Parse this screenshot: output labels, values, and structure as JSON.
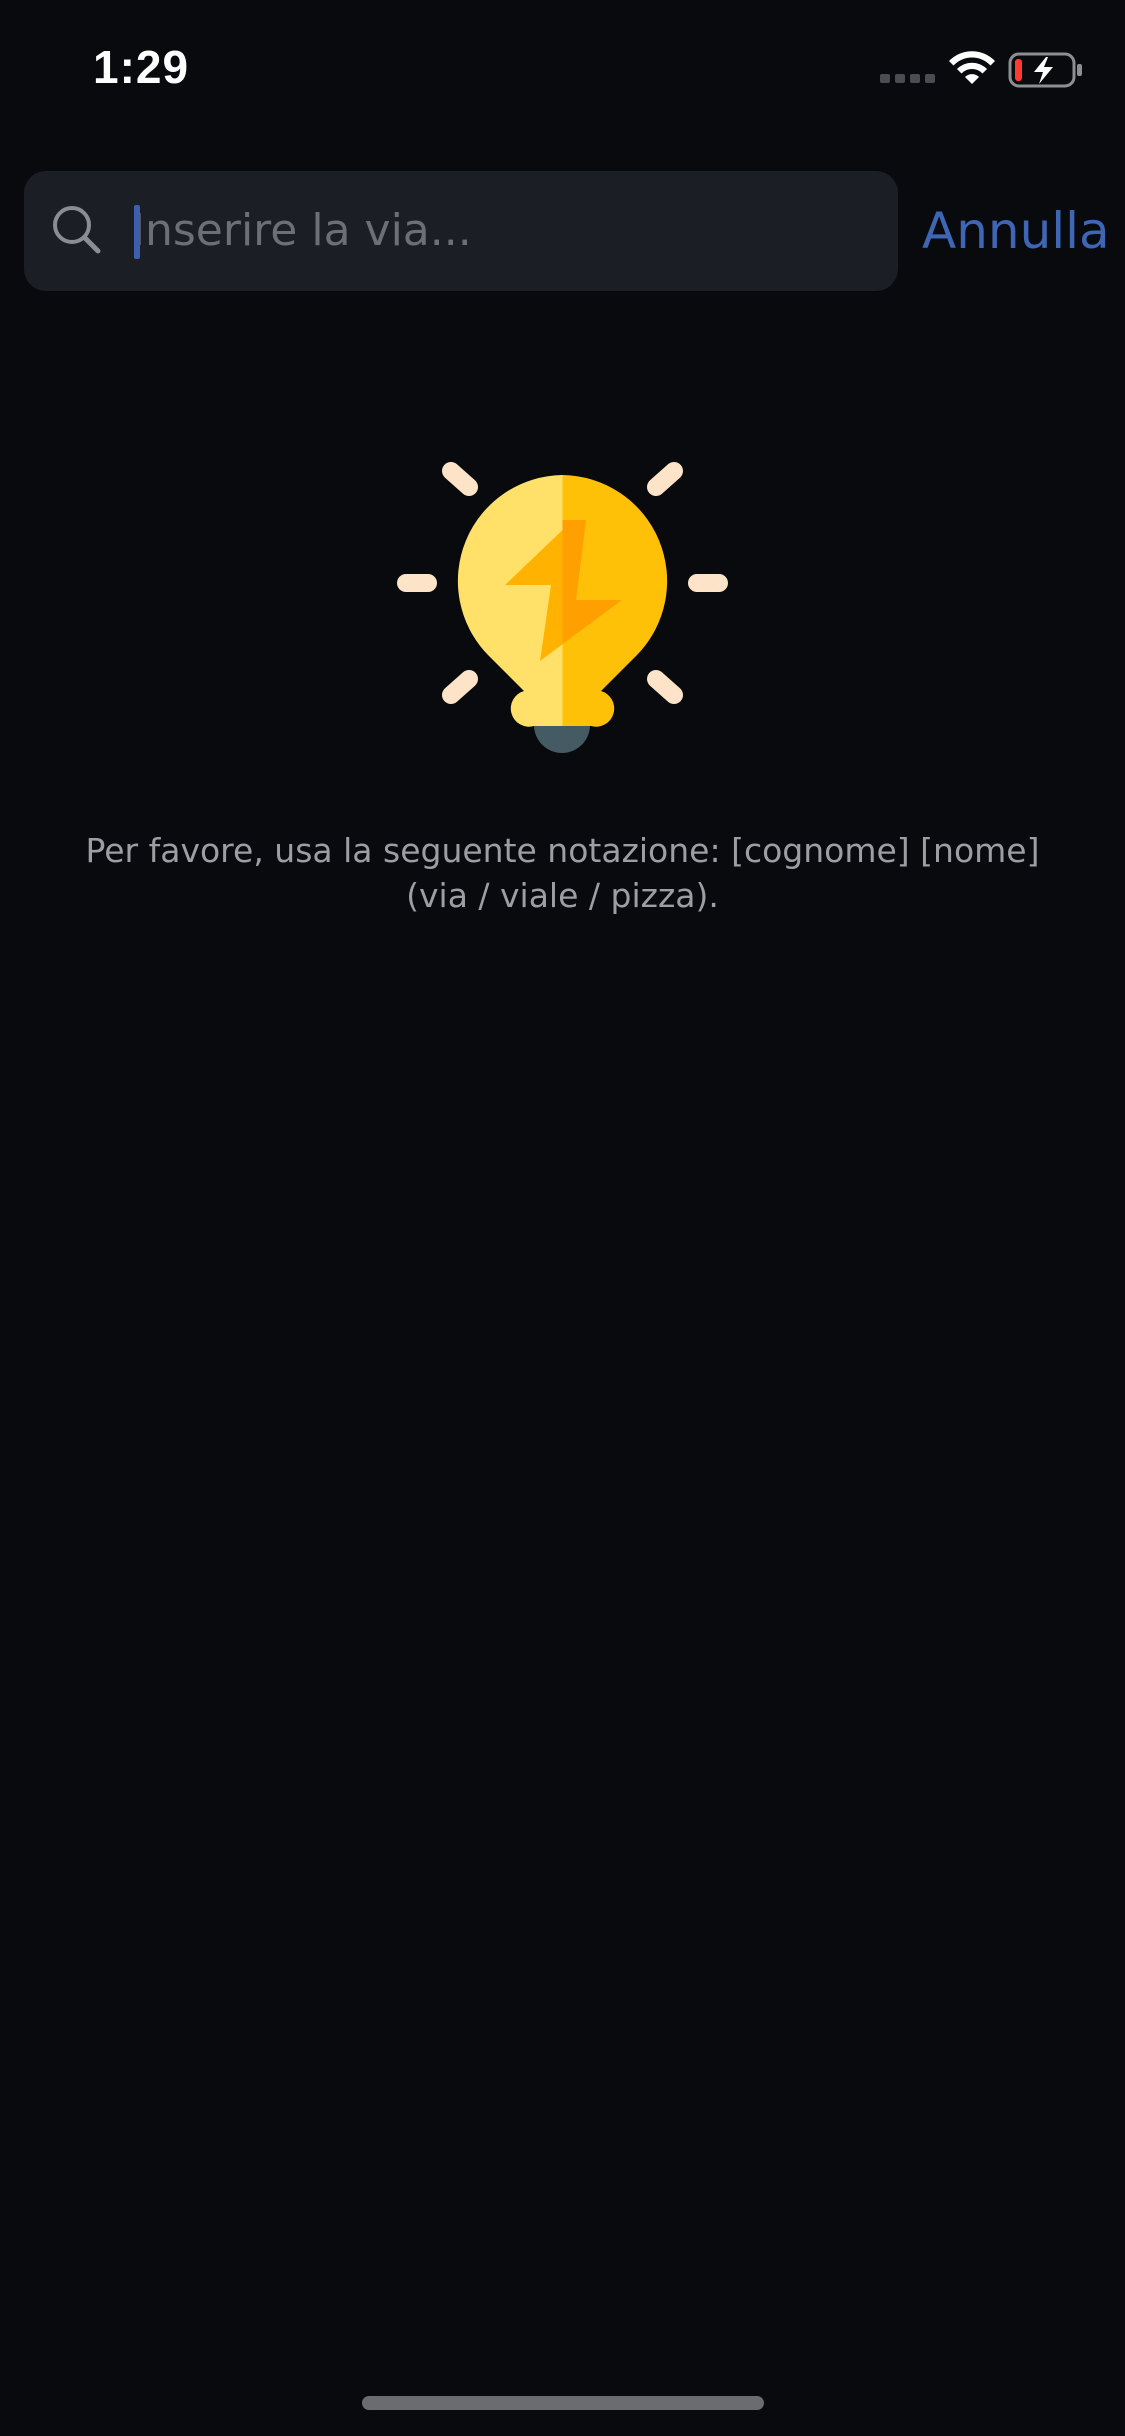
{
  "status_bar": {
    "time": "1:29"
  },
  "search": {
    "placeholder": "Inserire la via...",
    "cancel_label": "Annulla"
  },
  "empty_state": {
    "icon": "lightbulb-icon",
    "hint": "Per favore, usa la seguente notazione: [cognome] [nome] (via / viale / pizza)."
  },
  "colors": {
    "background": "#080a0e",
    "search_field": "#1b1e25",
    "accent": "#3e66b4",
    "bulb_light": "#ffe16a",
    "bulb_dark": "#ffc107",
    "bolt": "#ffa000",
    "rays": "#fde3c8"
  }
}
